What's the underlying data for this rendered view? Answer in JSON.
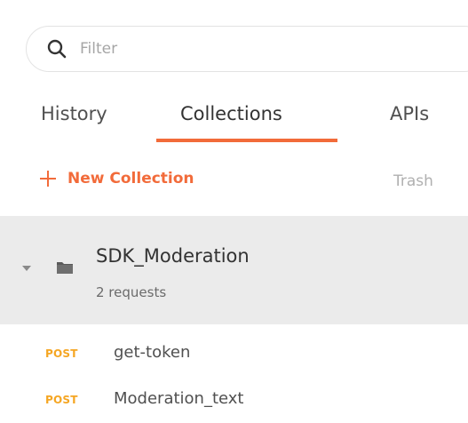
{
  "search": {
    "placeholder": "Filter",
    "value": ""
  },
  "tabs": [
    {
      "label": "History"
    },
    {
      "label": "Collections"
    },
    {
      "label": "APIs"
    }
  ],
  "active_tab": "Collections",
  "actions": {
    "new_collection_label": "New Collection",
    "trash_label": "Trash"
  },
  "collection": {
    "name": "SDK_Moderation",
    "count_label": "2 requests"
  },
  "requests": [
    {
      "method": "POST",
      "name": "get-token"
    },
    {
      "method": "POST",
      "name": "Moderation_text"
    }
  ],
  "colors": {
    "accent": "#f26b3a",
    "method_post": "#f5a623",
    "selected_bg": "#ebebeb"
  }
}
